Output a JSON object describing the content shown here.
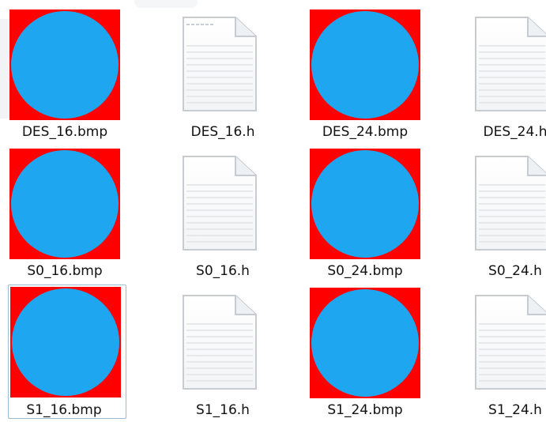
{
  "folder": {
    "files": [
      {
        "name": "DES_16.bmp",
        "kind": "bmp",
        "icon": "tag-icon",
        "colors": {
          "background": "#ff0000",
          "circle": "#1ea7f0",
          "symbol": "#ffffff"
        }
      },
      {
        "name": "DES_16.h",
        "kind": "header-file",
        "icon": "document-icon"
      },
      {
        "name": "DES_24.bmp",
        "kind": "bmp",
        "icon": "chart-icon",
        "colors": {
          "background": "#ff0000",
          "circle": "#1ea7f0",
          "symbol": "#ffffff"
        }
      },
      {
        "name": "DES_24.h",
        "kind": "header-file",
        "icon": "document-icon"
      },
      {
        "name": "S0_16.bmp",
        "kind": "bmp",
        "icon": "battery-icon",
        "colors": {
          "background": "#ff0000",
          "circle": "#1ea7f0",
          "symbol": "#ffffff"
        }
      },
      {
        "name": "S0_16.h",
        "kind": "header-file",
        "icon": "document-icon"
      },
      {
        "name": "S0_24.bmp",
        "kind": "bmp",
        "icon": "gear-icon",
        "colors": {
          "background": "#ff0000",
          "circle": "#1ea7f0",
          "symbol": "#ffffff"
        }
      },
      {
        "name": "S0_24.h",
        "kind": "header-file",
        "icon": "document-icon"
      },
      {
        "name": "S1_16.bmp",
        "kind": "bmp",
        "icon": "lightbulb-icon",
        "selected": true,
        "colors": {
          "background": "#ff0000",
          "circle": "#1ea7f0",
          "symbol": "#ffffff"
        }
      },
      {
        "name": "S1_16.h",
        "kind": "header-file",
        "icon": "document-icon"
      },
      {
        "name": "S1_24.bmp",
        "kind": "bmp",
        "icon": "smiley-icon",
        "colors": {
          "background": "#ff0000",
          "circle": "#1ea7f0",
          "symbol": "#ffffff"
        }
      },
      {
        "name": "S1_24.h",
        "kind": "header-file",
        "icon": "document-icon"
      }
    ]
  }
}
